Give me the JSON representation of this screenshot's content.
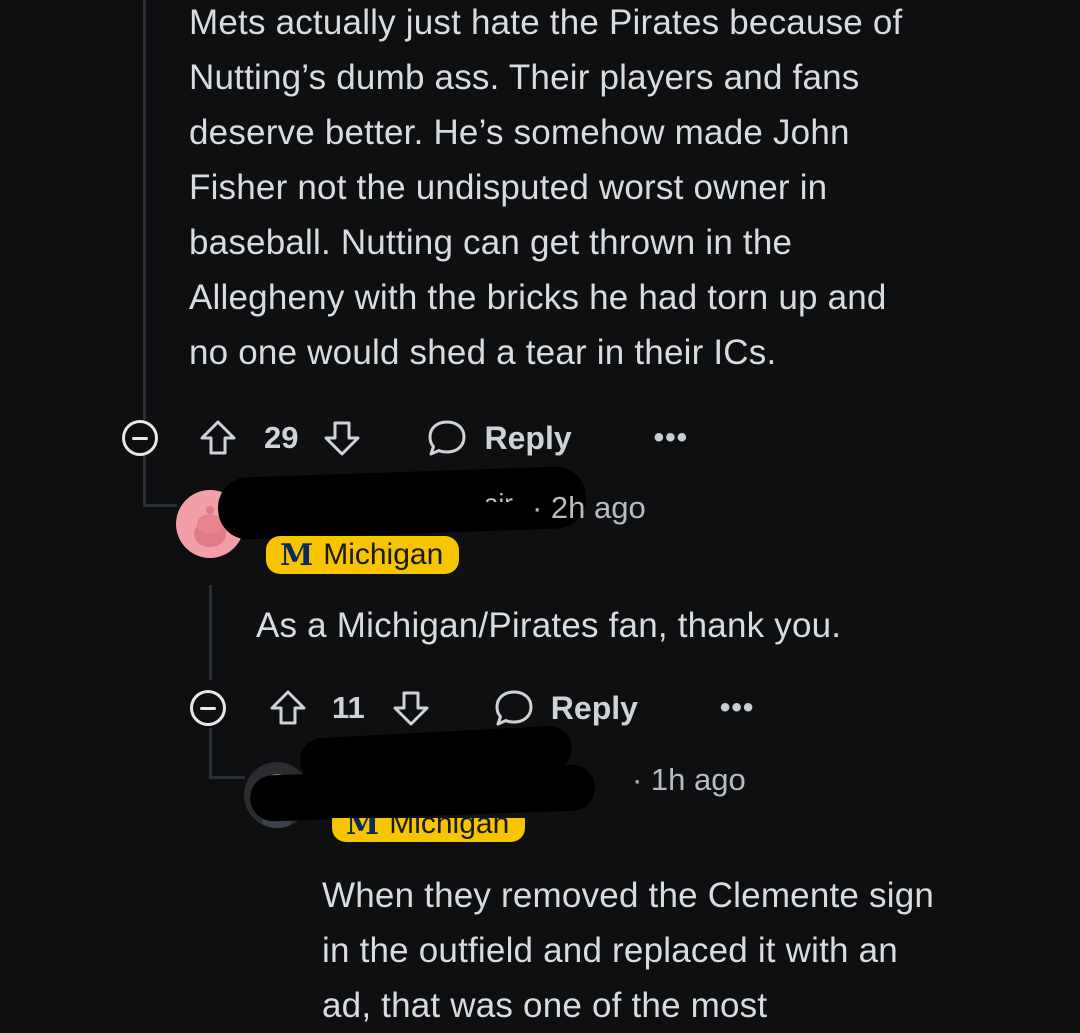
{
  "comment1": {
    "text": "Mets actually just hate the Pirates because of\nNutting’s dumb ass. Their players and fans\ndeserve better. He’s somehow made John\nFisher not the undisputed worst owner in\nbaseball. Nutting can get thrown in the\nAllegheny with the bricks he had torn up and\nno one would shed a tear in their ICs.",
    "votes": "29",
    "reply_label": "Reply",
    "more": "•••"
  },
  "comment2": {
    "username_fragment": "air",
    "time": "· 2h ago",
    "flair_letter": "M",
    "flair": "Michigan",
    "text": "As a Michigan/Pirates fan, thank you.",
    "votes": "11",
    "reply_label": "Reply",
    "more": "•••"
  },
  "comment3": {
    "time": "· 1h ago",
    "flair_letter": "M",
    "flair": "Michigan",
    "text": "When they removed the Clemente sign\nin the outfield and replaced it with an\nad, that was one of the most"
  },
  "colors": {
    "background": "#0e0f11",
    "flair_bg": "#f7c500",
    "avatar_pink": "#f39fa7"
  }
}
